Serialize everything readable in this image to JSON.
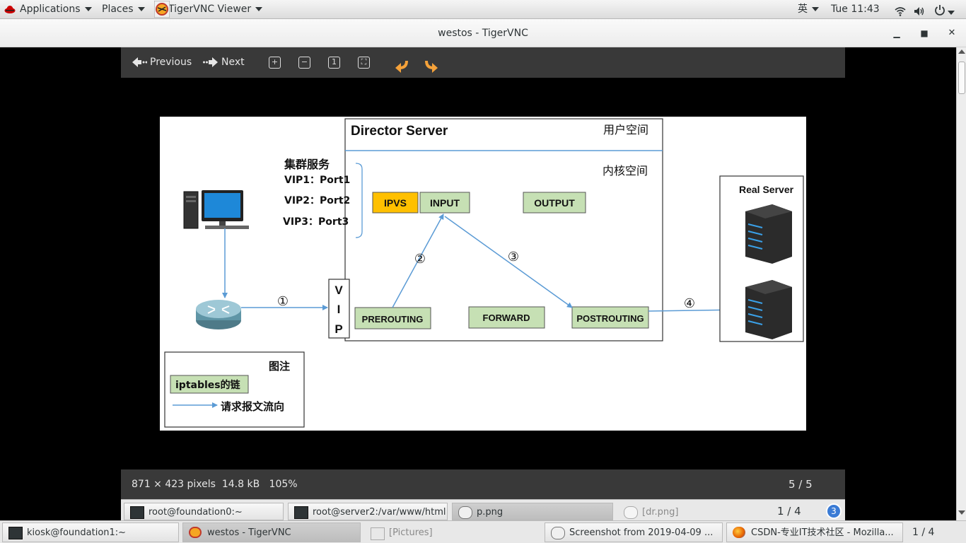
{
  "topbar": {
    "applications": "Applications",
    "places": "Places",
    "active_app": "TigerVNC Viewer",
    "input_method": "英",
    "clock": "Tue 11:43"
  },
  "window": {
    "title": "westos - TigerVNC"
  },
  "viewer": {
    "previous": "Previous",
    "next": "Next",
    "status_info": "871 × 423 pixels  14.8 kB   105%",
    "page_counter": "5 / 5"
  },
  "diagram": {
    "director_title": "Director Server",
    "user_space": "用户空间",
    "kernel_space": "内核空间",
    "cluster_service": "集群服务",
    "vip1": "VIP1：Port1",
    "vip2": "VIP2：Port2",
    "vip3": "VIP3：Port3",
    "ipvs": "IPVS",
    "input": "INPUT",
    "output": "OUTPUT",
    "prerouting": "PREROUTING",
    "forward": "FORWARD",
    "postrouting": "POSTROUTING",
    "vip_v": "V",
    "vip_i": "I",
    "vip_p": "P",
    "step1": "①",
    "step2": "②",
    "step3": "③",
    "step4": "④",
    "real_server": "Real Server",
    "legend_title": "图注",
    "legend_chain": "iptables的链",
    "legend_flow": "请求报文流向",
    "colors": {
      "chain_fill": "#c6e0b4",
      "ipvs_fill": "#ffc000",
      "flow_arrow": "#5b9bd5"
    }
  },
  "inner_taskbar": {
    "items": [
      "root@foundation0:~",
      "root@server2:/var/www/html",
      "p.png",
      "[dr.png]"
    ],
    "pager": "1 / 4",
    "badge": "3"
  },
  "outer_taskbar": {
    "items": [
      "kiosk@foundation1:~",
      "westos - TigerVNC",
      "[Pictures]",
      "Screenshot from 2019-04-09 ...",
      "CSDN-专业IT技术社区 - Mozilla..."
    ],
    "pager": "1 / 4"
  }
}
